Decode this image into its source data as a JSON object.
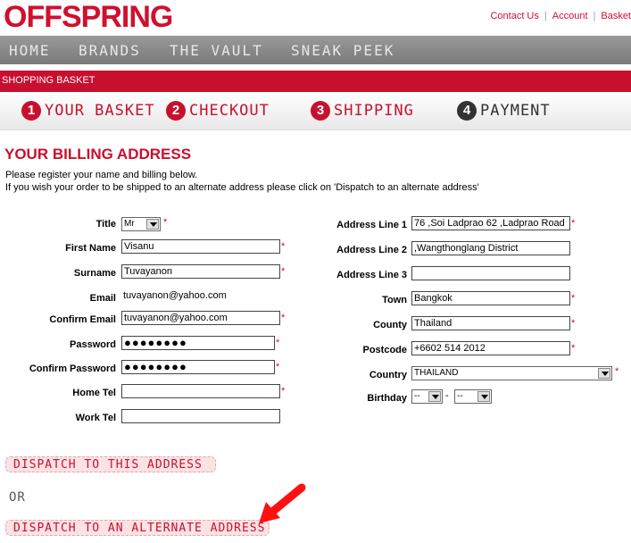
{
  "brand": {
    "logo": "OFFSPRING",
    "accent": "#c8102e"
  },
  "top_links": [
    "Contact Us",
    "Account",
    "Basket"
  ],
  "nav": [
    "HOME",
    "BRANDS",
    "THE VAULT",
    "SNEAK PEEK"
  ],
  "section_bar": "SHOPPING BASKET",
  "steps": [
    {
      "num": "1",
      "label": "YOUR BASKET"
    },
    {
      "num": "2",
      "label": "CHECKOUT"
    },
    {
      "num": "3",
      "label": "SHIPPING"
    },
    {
      "num": "4",
      "label": "PAYMENT"
    }
  ],
  "heading": "YOUR BILLING ADDRESS",
  "intro": [
    "Please register your name and billing below.",
    "If you wish your order to be shipped to an alternate address please click on 'Dispatch to an alternate address'"
  ],
  "form_left": {
    "title": {
      "label": "Title",
      "value": "Mr"
    },
    "first_name": {
      "label": "First Name",
      "value": "Visanu"
    },
    "surname": {
      "label": "Surname",
      "value": "Tuvayanon"
    },
    "email": {
      "label": "Email",
      "value": "tuvayanon@yahoo.com"
    },
    "confirm_email": {
      "label": "Confirm Email",
      "value": "tuvayanon@yahoo.com"
    },
    "password": {
      "label": "Password",
      "value": "●●●●●●●●"
    },
    "confirm_password": {
      "label": "Confirm Password",
      "value": "●●●●●●●●"
    },
    "home_tel": {
      "label": "Home Tel",
      "value": ""
    },
    "work_tel": {
      "label": "Work Tel",
      "value": ""
    }
  },
  "form_right": {
    "address1": {
      "label": "Address Line 1",
      "value": "76 ,Soi Ladprao 62 ,Ladprao Road"
    },
    "address2": {
      "label": "Address Line 2",
      "value": ",Wangthonglang  District"
    },
    "address3": {
      "label": "Address Line 3",
      "value": ""
    },
    "town": {
      "label": "Town",
      "value": "Bangkok"
    },
    "county": {
      "label": "County",
      "value": "Thailand"
    },
    "postcode": {
      "label": "Postcode",
      "value": "+6602 514 2012"
    },
    "country": {
      "label": "Country",
      "value": "THAILAND"
    },
    "birthday": {
      "label": "Birthday",
      "day": "--",
      "month": "--",
      "separator": "-"
    }
  },
  "required_mark": "*",
  "buttons": {
    "dispatch_this": "DISPATCH TO THIS ADDRESS",
    "or": "OR",
    "dispatch_alternate": "DISPATCH TO AN ALTERNATE ADDRESS"
  }
}
